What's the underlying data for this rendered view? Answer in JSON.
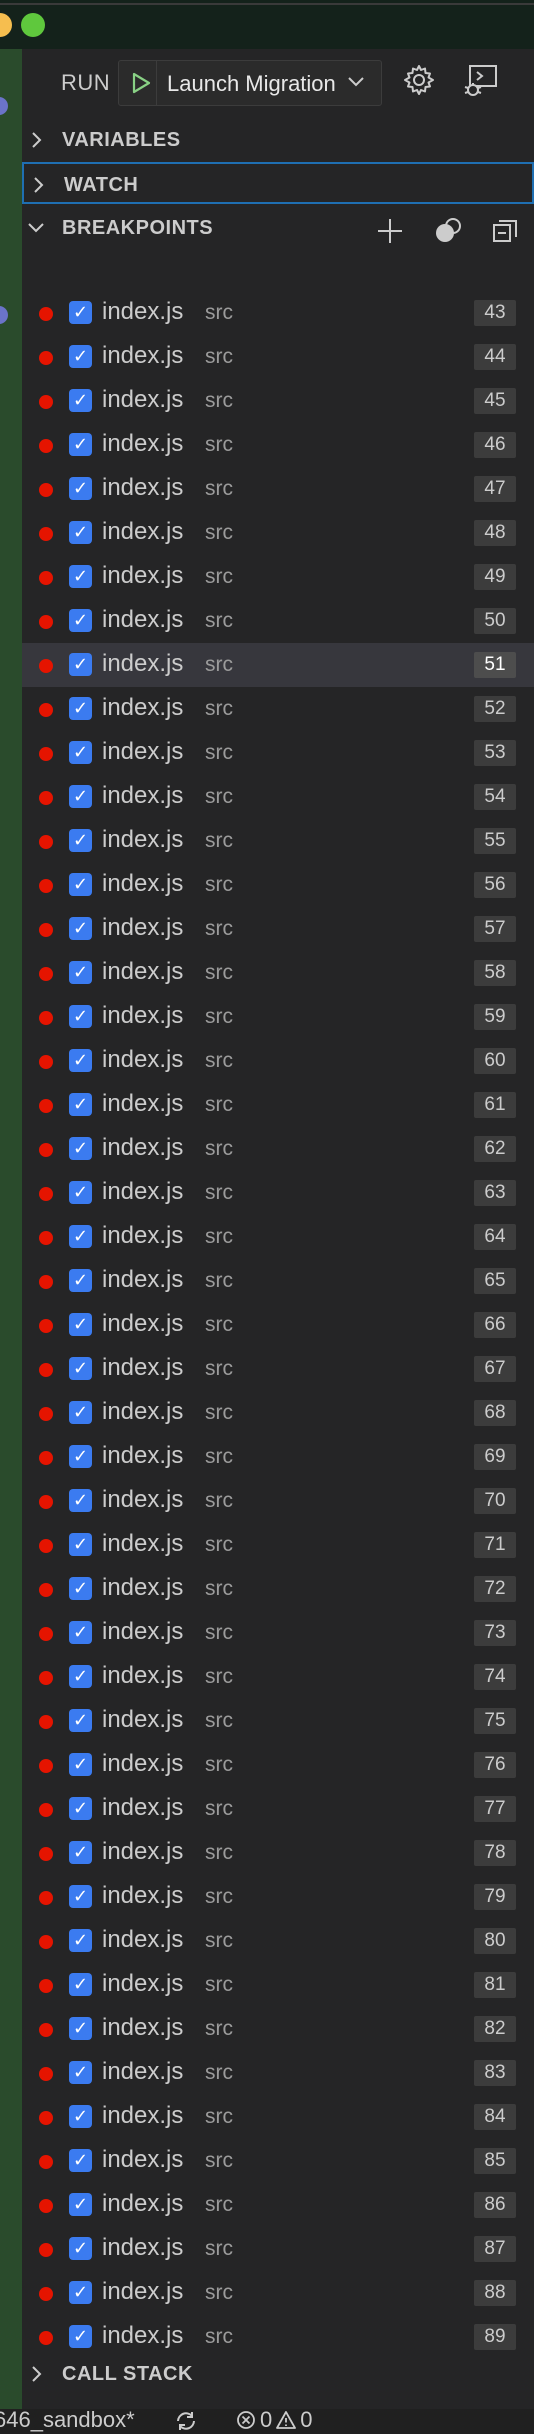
{
  "run": {
    "label": "RUN",
    "configuration": "Launch Migration"
  },
  "sections": {
    "variables": "VARIABLES",
    "watch": "WATCH",
    "breakpoints": "BREAKPOINTS",
    "call_stack": "CALL STACK"
  },
  "breakpoints": [
    {
      "file": "index.js",
      "dir": "src",
      "line": "43"
    },
    {
      "file": "index.js",
      "dir": "src",
      "line": "44"
    },
    {
      "file": "index.js",
      "dir": "src",
      "line": "45"
    },
    {
      "file": "index.js",
      "dir": "src",
      "line": "46"
    },
    {
      "file": "index.js",
      "dir": "src",
      "line": "47"
    },
    {
      "file": "index.js",
      "dir": "src",
      "line": "48"
    },
    {
      "file": "index.js",
      "dir": "src",
      "line": "49"
    },
    {
      "file": "index.js",
      "dir": "src",
      "line": "50"
    },
    {
      "file": "index.js",
      "dir": "src",
      "line": "51"
    },
    {
      "file": "index.js",
      "dir": "src",
      "line": "52"
    },
    {
      "file": "index.js",
      "dir": "src",
      "line": "53"
    },
    {
      "file": "index.js",
      "dir": "src",
      "line": "54"
    },
    {
      "file": "index.js",
      "dir": "src",
      "line": "55"
    },
    {
      "file": "index.js",
      "dir": "src",
      "line": "56"
    },
    {
      "file": "index.js",
      "dir": "src",
      "line": "57"
    },
    {
      "file": "index.js",
      "dir": "src",
      "line": "58"
    },
    {
      "file": "index.js",
      "dir": "src",
      "line": "59"
    },
    {
      "file": "index.js",
      "dir": "src",
      "line": "60"
    },
    {
      "file": "index.js",
      "dir": "src",
      "line": "61"
    },
    {
      "file": "index.js",
      "dir": "src",
      "line": "62"
    },
    {
      "file": "index.js",
      "dir": "src",
      "line": "63"
    },
    {
      "file": "index.js",
      "dir": "src",
      "line": "64"
    },
    {
      "file": "index.js",
      "dir": "src",
      "line": "65"
    },
    {
      "file": "index.js",
      "dir": "src",
      "line": "66"
    },
    {
      "file": "index.js",
      "dir": "src",
      "line": "67"
    },
    {
      "file": "index.js",
      "dir": "src",
      "line": "68"
    },
    {
      "file": "index.js",
      "dir": "src",
      "line": "69"
    },
    {
      "file": "index.js",
      "dir": "src",
      "line": "70"
    },
    {
      "file": "index.js",
      "dir": "src",
      "line": "71"
    },
    {
      "file": "index.js",
      "dir": "src",
      "line": "72"
    },
    {
      "file": "index.js",
      "dir": "src",
      "line": "73"
    },
    {
      "file": "index.js",
      "dir": "src",
      "line": "74"
    },
    {
      "file": "index.js",
      "dir": "src",
      "line": "75"
    },
    {
      "file": "index.js",
      "dir": "src",
      "line": "76"
    },
    {
      "file": "index.js",
      "dir": "src",
      "line": "77"
    },
    {
      "file": "index.js",
      "dir": "src",
      "line": "78"
    },
    {
      "file": "index.js",
      "dir": "src",
      "line": "79"
    },
    {
      "file": "index.js",
      "dir": "src",
      "line": "80"
    },
    {
      "file": "index.js",
      "dir": "src",
      "line": "81"
    },
    {
      "file": "index.js",
      "dir": "src",
      "line": "82"
    },
    {
      "file": "index.js",
      "dir": "src",
      "line": "83"
    },
    {
      "file": "index.js",
      "dir": "src",
      "line": "84"
    },
    {
      "file": "index.js",
      "dir": "src",
      "line": "85"
    },
    {
      "file": "index.js",
      "dir": "src",
      "line": "86"
    },
    {
      "file": "index.js",
      "dir": "src",
      "line": "87"
    },
    {
      "file": "index.js",
      "dir": "src",
      "line": "88"
    },
    {
      "file": "index.js",
      "dir": "src",
      "line": "89"
    }
  ],
  "selected_line": "51",
  "statusbar": {
    "branch": "646_sandbox*",
    "errors": "0",
    "warnings": "0"
  },
  "icons": {
    "run": "play-icon",
    "settings": "gear-icon",
    "console": "debug-console-icon",
    "add": "plus-icon",
    "toggle": "toggle-breakpoints-icon",
    "collapse": "collapse-all-icon"
  },
  "colors": {
    "breakpoint": "#e51400",
    "checkbox": "#3b7bf0",
    "run_green": "#89d185",
    "focus": "#1f6fb2"
  }
}
